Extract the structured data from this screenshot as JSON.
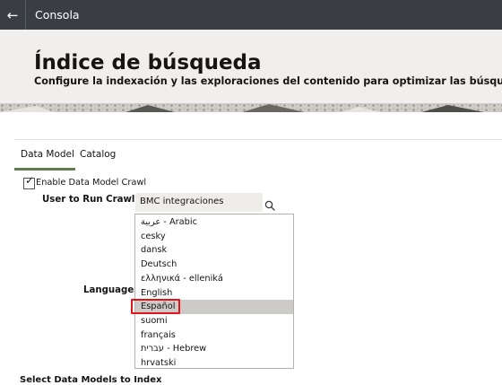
{
  "topbar": {
    "back_icon": "arrow-left-icon",
    "title": "Consola"
  },
  "header": {
    "title": "Índice de búsqueda",
    "subtitle": "Configure la indexación y las exploraciones del contenido para optimizar las búsquedas del usuario"
  },
  "tabs": [
    {
      "label": "Data Model",
      "active": true
    },
    {
      "label": "Catalog",
      "active": false
    }
  ],
  "form": {
    "enable_crawl": {
      "label": "Enable Data Model Crawl",
      "checked": true
    },
    "user_label": "User to Run Crawl As",
    "user_value": "BMC integraciones",
    "search_icon": "search-icon",
    "languages_label": "Languages",
    "languages": [
      "عربية - Arabic",
      "cesky",
      "dansk",
      "Deutsch",
      "ελληνικά - elleniká",
      "English",
      "Español",
      "suomi",
      "français",
      "עברית - Hebrew",
      "hrvatski"
    ],
    "selected_language": "Español",
    "next_section_label": "Select Data Models to Index"
  },
  "colors": {
    "topbar_bg": "#3a3e44",
    "hero_bg": "#f1efed",
    "tab_underline": "#5f7d4f",
    "selection_bg": "#cdcbc8",
    "highlight_border": "#e0141b"
  }
}
